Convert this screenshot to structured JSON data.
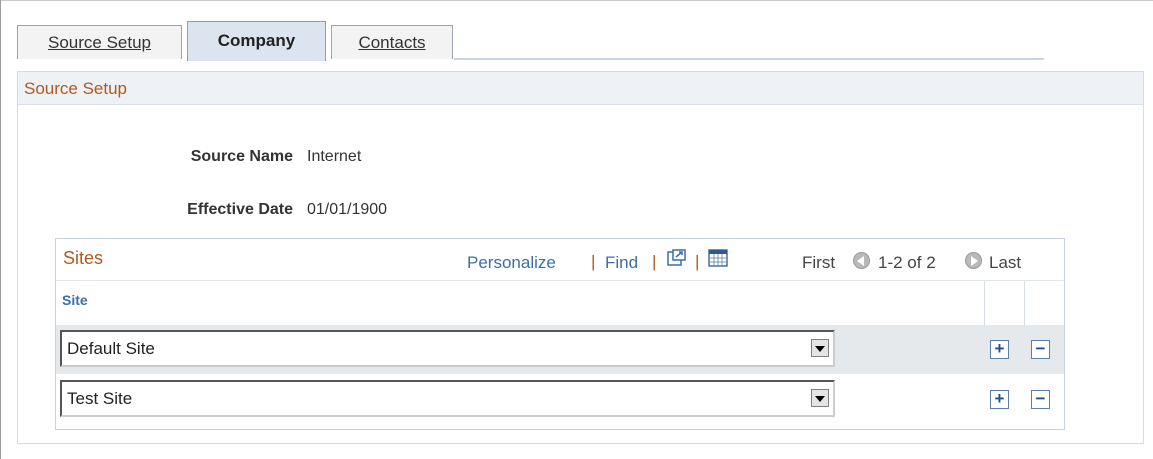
{
  "tabs": [
    {
      "label": "Source Setup",
      "active": false
    },
    {
      "label": "Company",
      "active": true
    },
    {
      "label": "Contacts",
      "active": false
    }
  ],
  "section": {
    "title": "Source Setup"
  },
  "fields": {
    "source_name": {
      "label": "Source Name",
      "value": "Internet"
    },
    "effective_date": {
      "label": "Effective Date",
      "value": "01/01/1900"
    }
  },
  "grid": {
    "title": "Sites",
    "personalize": "Personalize",
    "find": "Find",
    "separator": "|",
    "first": "First",
    "range": "1-2 of 2",
    "last": "Last",
    "column_site": "Site",
    "rows": [
      {
        "site": "Default Site"
      },
      {
        "site": "Test Site"
      }
    ],
    "add_symbol": "+",
    "remove_symbol": "−"
  },
  "colors": {
    "section_title": "#b1591e",
    "link": "#3d6fa8",
    "active_tab": "#dbe4ef"
  },
  "icons": [
    "view-all-icon",
    "download-excel-icon",
    "previous-arrow-icon",
    "next-arrow-icon",
    "add-row-icon",
    "delete-row-icon",
    "dropdown-arrow-icon"
  ]
}
